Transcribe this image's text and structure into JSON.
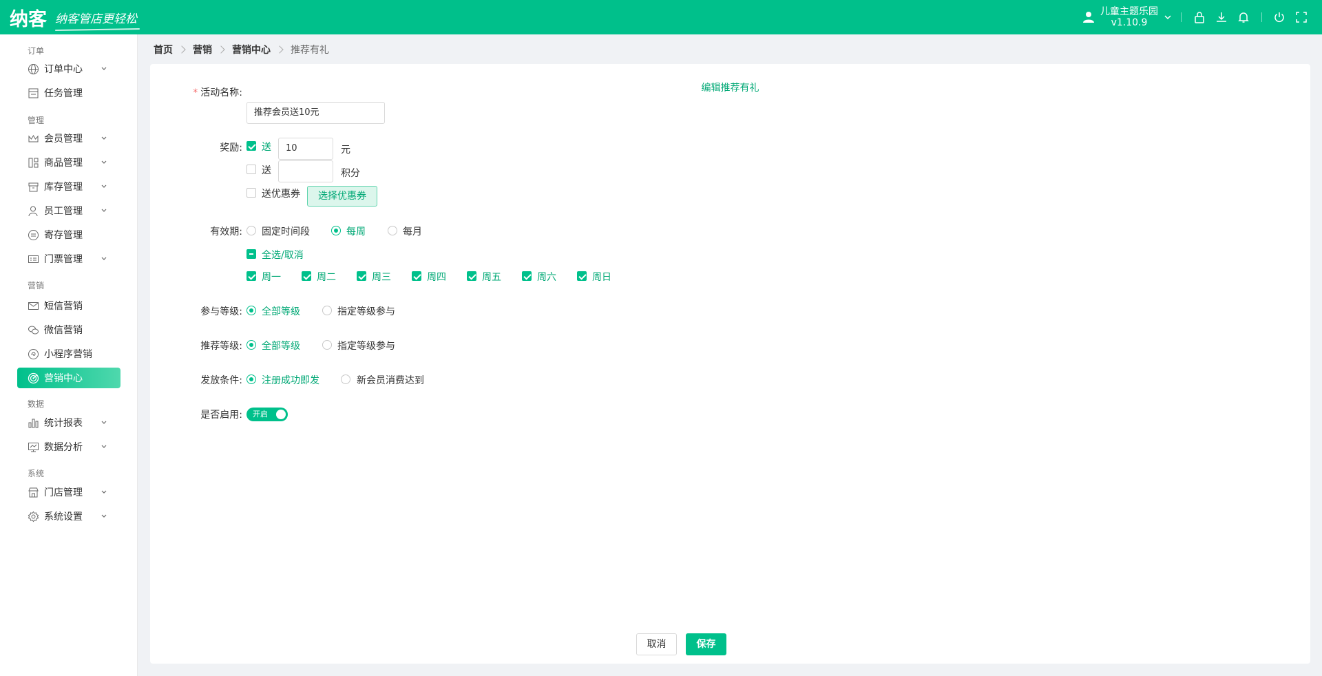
{
  "header": {
    "logo_text": "纳客",
    "slogan": "纳客管店更轻松",
    "store_name": "儿童主题乐园",
    "version": "v1.10.9"
  },
  "sidebar": {
    "groups": {
      "order": "订单",
      "manage": "管理",
      "marketing": "营销",
      "data": "数据",
      "system": "系统"
    },
    "items": [
      {
        "label": "订单中心",
        "icon": "globe-icon",
        "has_children": true
      },
      {
        "label": "任务管理",
        "icon": "task-icon",
        "has_children": false
      },
      {
        "label": "会员管理",
        "icon": "crown-icon",
        "has_children": true
      },
      {
        "label": "商品管理",
        "icon": "grid-icon",
        "has_children": true
      },
      {
        "label": "库存管理",
        "icon": "box-icon",
        "has_children": true
      },
      {
        "label": "员工管理",
        "icon": "user-icon",
        "has_children": true
      },
      {
        "label": "寄存管理",
        "icon": "storage-icon",
        "has_children": false
      },
      {
        "label": "门票管理",
        "icon": "ticket-icon",
        "has_children": true
      },
      {
        "label": "短信营销",
        "icon": "mail-icon",
        "has_children": false
      },
      {
        "label": "微信营销",
        "icon": "wechat-icon",
        "has_children": false
      },
      {
        "label": "小程序营销",
        "icon": "miniprogram-icon",
        "has_children": false
      },
      {
        "label": "营销中心",
        "icon": "target-icon",
        "has_children": false,
        "active": true
      },
      {
        "label": "统计报表",
        "icon": "bar-chart-icon",
        "has_children": true
      },
      {
        "label": "数据分析",
        "icon": "monitor-icon",
        "has_children": true
      },
      {
        "label": "门店管理",
        "icon": "store-icon",
        "has_children": true
      },
      {
        "label": "系统设置",
        "icon": "gear-icon",
        "has_children": true
      }
    ]
  },
  "breadcrumb": [
    "首页",
    "营销",
    "营销中心",
    "推荐有礼"
  ],
  "form": {
    "title": "编辑推荐有礼",
    "activity_name": {
      "label": "活动名称:",
      "value": "推荐会员送10元"
    },
    "reward": {
      "label": "奖励:",
      "cash": {
        "checked": true,
        "prefix": "送",
        "value": "10",
        "unit": "元"
      },
      "points": {
        "checked": false,
        "prefix": "送",
        "value": "",
        "unit": "积分"
      },
      "coupon": {
        "checked": false,
        "label": "送优惠券",
        "button": "选择优惠券"
      }
    },
    "validity": {
      "label": "有效期:",
      "options": [
        "固定时间段",
        "每周",
        "每月"
      ],
      "selected": "每周",
      "select_all": "全选/取消",
      "weekdays": [
        "周一",
        "周二",
        "周三",
        "周四",
        "周五",
        "周六",
        "周日"
      ]
    },
    "join_level": {
      "label": "参与等级:",
      "options": [
        "全部等级",
        "指定等级参与"
      ],
      "selected": "全部等级"
    },
    "referrer_level": {
      "label": "推荐等级:",
      "options": [
        "全部等级",
        "指定等级参与"
      ],
      "selected": "全部等级"
    },
    "issue_condition": {
      "label": "发放条件:",
      "options": [
        "注册成功即发",
        "新会员消费达到"
      ],
      "selected": "注册成功即发"
    },
    "enabled": {
      "label": "是否启用:",
      "switch_text": "开启",
      "on": true
    },
    "buttons": {
      "cancel": "取消",
      "save": "保存"
    }
  },
  "colors": {
    "brand": "#00c08b",
    "brand_text": "#00a875",
    "required": "#f56c6c"
  }
}
